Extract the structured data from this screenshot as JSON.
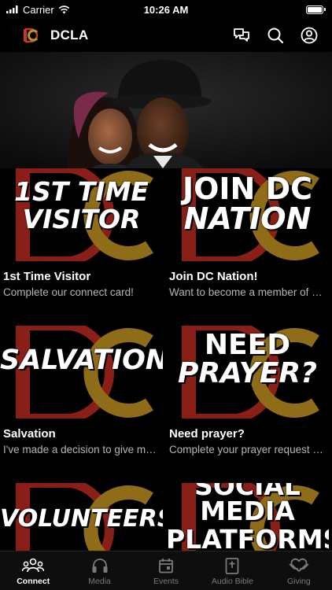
{
  "status_bar": {
    "carrier": "Carrier",
    "time": "10:26 AM",
    "battery_level": 1.0
  },
  "header": {
    "title": "DCLA",
    "icons": [
      "chat-icon",
      "search-icon",
      "profile-icon"
    ]
  },
  "hero": {
    "icon": "couple-photo"
  },
  "tiles": [
    {
      "art_text_1": "1ST TIME",
      "art_text_2": "VISITOR",
      "title": "1st Time Visitor",
      "subtitle": "Complete our connect card!"
    },
    {
      "art_text_1": "JOIN DC",
      "art_text_2": "NATION",
      "title": "Join DC Nation!",
      "subtitle": "Want to become a member of DC Nation?"
    },
    {
      "art_text_1": "SALVATION",
      "art_text_2": "",
      "title": "Salvation",
      "subtitle": "I've made a decision to give my life to Christ"
    },
    {
      "art_text_1": "NEED",
      "art_text_2": "PRAYER?",
      "title": "Need prayer?",
      "subtitle": "Complete your prayer request form"
    },
    {
      "art_text_1": "VOLUNTEERS",
      "art_text_2": "",
      "title": "",
      "subtitle": ""
    },
    {
      "art_text_1": "SOCIAL",
      "art_text_2": "MEDIA",
      "art_text_3": "PLATFORMS",
      "title": "",
      "subtitle": ""
    }
  ],
  "tabs": [
    {
      "label": "Connect",
      "icon": "people-icon",
      "active": true
    },
    {
      "label": "Media",
      "icon": "headphones-icon",
      "active": false
    },
    {
      "label": "Events",
      "icon": "calendar-icon",
      "active": false
    },
    {
      "label": "Audio Bible",
      "icon": "bible-icon",
      "active": false
    },
    {
      "label": "Giving",
      "icon": "heart-hand-icon",
      "active": false
    }
  ],
  "colors": {
    "background": "#000000",
    "brand_red": "#c0392b",
    "brand_gold": "#b8932a",
    "subtitle_gray": "#b5b5b5",
    "tab_inactive": "#7a7a7a"
  }
}
